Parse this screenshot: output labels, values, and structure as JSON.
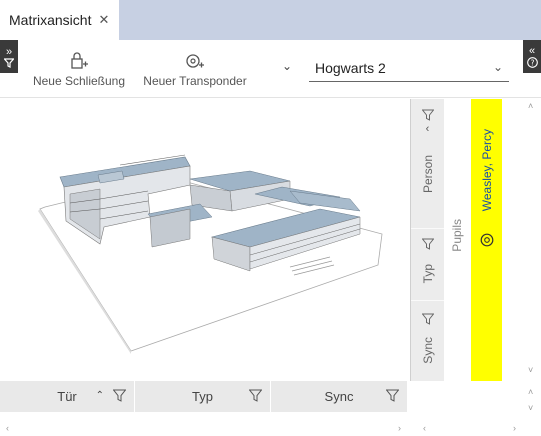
{
  "tab": {
    "title": "Matrixansicht",
    "close_glyph": "✕"
  },
  "toolbar": {
    "left_toggle": "»",
    "right_toggle": "«",
    "new_lock_label": "Neue Schließung",
    "new_transponder_label": "Neuer Transponder",
    "more_glyph": "⌄",
    "site_select": "Hogwarts 2"
  },
  "filters": {
    "person_label": "Person",
    "type_label": "Typ",
    "sync_label": "Sync"
  },
  "group": {
    "label": "Pupils"
  },
  "person": {
    "name": "Weasley, Percy",
    "highlight_color": "#ffff00"
  },
  "table_headers": {
    "door": "Tür",
    "type": "Typ",
    "sync": "Sync"
  },
  "colors": {
    "tabbar": "#c7d0e3",
    "filter_bg": "#ececec",
    "name_text": "#1a4fa6"
  }
}
